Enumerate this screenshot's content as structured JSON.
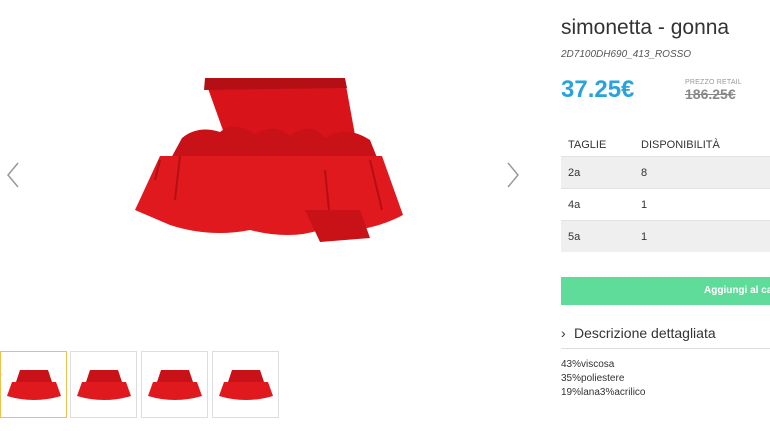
{
  "product": {
    "title": "simonetta - gonna",
    "sku": "2D7100DH690_413_ROSSO",
    "price": "37.25€",
    "retail_label": "PREZZO RETAIL",
    "retail_price": "186.25€"
  },
  "table": {
    "headers": [
      "TAGLIE",
      "DISPONIBILITÀ"
    ],
    "rows": [
      {
        "size": "2a",
        "qty": "8"
      },
      {
        "size": "4a",
        "qty": "1"
      },
      {
        "size": "5a",
        "qty": "1"
      }
    ]
  },
  "add_button": "Aggiungi al ca",
  "description": {
    "label": "Descrizione dettagliata",
    "chevron": "›",
    "composition": [
      "43%viscosa",
      "35%poliestere",
      "19%lana3%acrilico"
    ]
  },
  "icons": {
    "prev": "chevron-left-icon",
    "next": "chevron-right-icon"
  },
  "colors": {
    "price": "#2aa3dd",
    "button": "#5fdc9a",
    "skirt": "#e0191e",
    "thumb_active": "#f0c24b"
  }
}
